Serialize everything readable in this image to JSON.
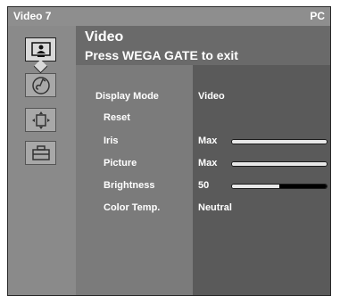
{
  "top_bar": {
    "left": "Video 7",
    "right": "PC"
  },
  "header": {
    "title": "Video",
    "subtitle": "Press WEGA GATE to exit"
  },
  "menu_icons": [
    "monitor-icon",
    "music-note-icon",
    "screen-adjust-icon",
    "toolbox-icon"
  ],
  "rows": [
    {
      "label": "Display Mode",
      "value": "Video"
    },
    {
      "label": "Reset",
      "value": ""
    },
    {
      "label": "Iris",
      "value": "Max",
      "slider_level": 1.0
    },
    {
      "label": "Picture",
      "value": "Max",
      "slider_level": 1.0
    },
    {
      "label": "Brightness",
      "value": "50",
      "slider_level": 0.5
    },
    {
      "label": "Color Temp.",
      "value": "Neutral"
    }
  ],
  "colors": {
    "panel_bg": "#7b7b7b",
    "value_bg": "#5a5a5a",
    "slider_fill": "#e8e8e8",
    "slider_rest": "#000000"
  }
}
